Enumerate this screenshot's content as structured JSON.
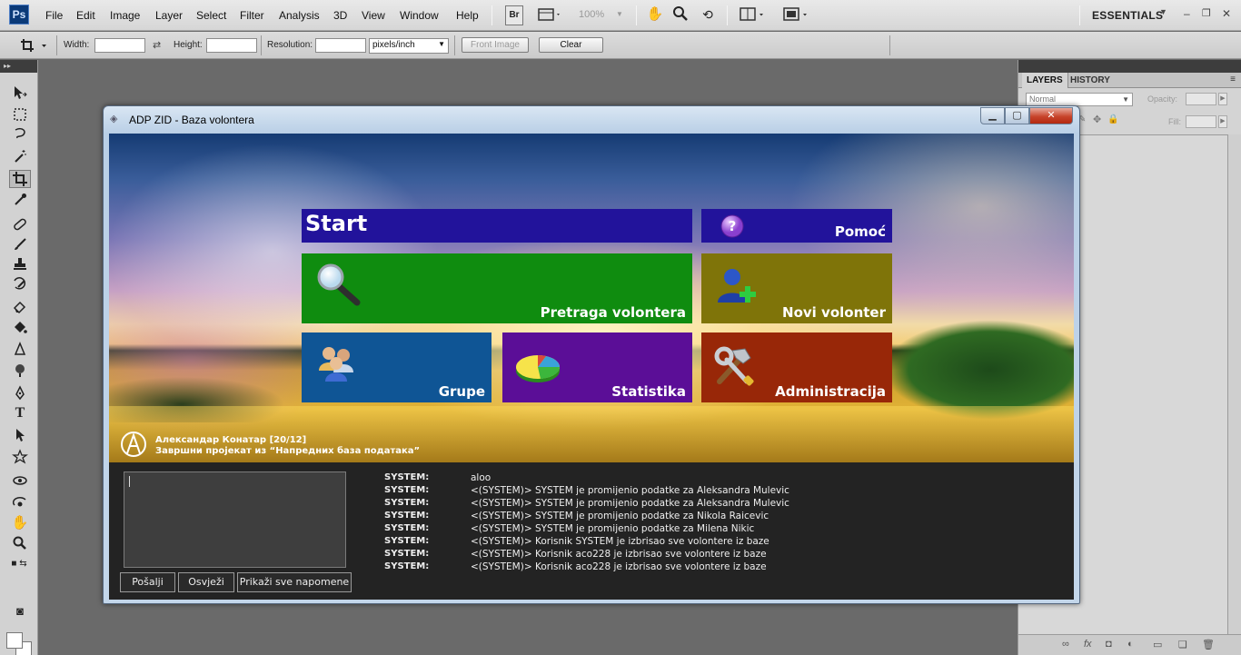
{
  "photoshop": {
    "logo": "Ps",
    "menu": [
      "File",
      "Edit",
      "Image",
      "Layer",
      "Select",
      "Filter",
      "Analysis",
      "3D",
      "View",
      "Window",
      "Help"
    ],
    "bridge_button": "Br",
    "zoom": "100%",
    "workspace": "ESSENTIALS",
    "options_bar": {
      "width_label": "Width:",
      "height_label": "Height:",
      "resolution_label": "Resolution:",
      "units": "pixels/inch",
      "front_image": "Front Image",
      "clear": "Clear"
    },
    "panels": {
      "tab_layers": "LAYERS",
      "tab_history": "HISTORY",
      "blend_mode": "Normal",
      "opacity_label": "Opacity:",
      "fill_label": "Fill:"
    }
  },
  "app": {
    "title": "ADP ZID - Baza volontera",
    "tiles": {
      "start": "Start",
      "help": "Pomoć",
      "search": "Pretraga volontera",
      "new_volunteer": "Novi volonter",
      "groups": "Grupe",
      "stats": "Statistika",
      "admin": "Administracija"
    },
    "credit": {
      "name": "Александар Конатар [20/12]",
      "subtitle": "Завршни пројекат из “Напредних база података”"
    },
    "buttons": {
      "send": "Pošalji",
      "refresh": "Osvježi",
      "show_all": "Prikaži sve napomene"
    },
    "log": [
      {
        "who": "SYSTEM:",
        "msg": "aloo"
      },
      {
        "who": "SYSTEM:",
        "msg": "<(SYSTEM)>  SYSTEM je promijenio podatke za Aleksandra Mulevic"
      },
      {
        "who": "SYSTEM:",
        "msg": "<(SYSTEM)>  SYSTEM je promijenio podatke za Aleksandra Mulevic"
      },
      {
        "who": "SYSTEM:",
        "msg": "<(SYSTEM)>  SYSTEM je promijenio podatke za Nikola Raicevic"
      },
      {
        "who": "SYSTEM:",
        "msg": "<(SYSTEM)>  SYSTEM je promijenio podatke za Milena Nikic"
      },
      {
        "who": "SYSTEM:",
        "msg": "<(SYSTEM)>  Korisnik SYSTEM je izbrisao sve volontere iz baze"
      },
      {
        "who": "SYSTEM:",
        "msg": "<(SYSTEM)>  Korisnik aco228 je izbrisao sve volontere iz baze"
      },
      {
        "who": "SYSTEM:",
        "msg": "<(SYSTEM)>  Korisnik aco228 je izbrisao sve volontere iz baze"
      }
    ]
  }
}
